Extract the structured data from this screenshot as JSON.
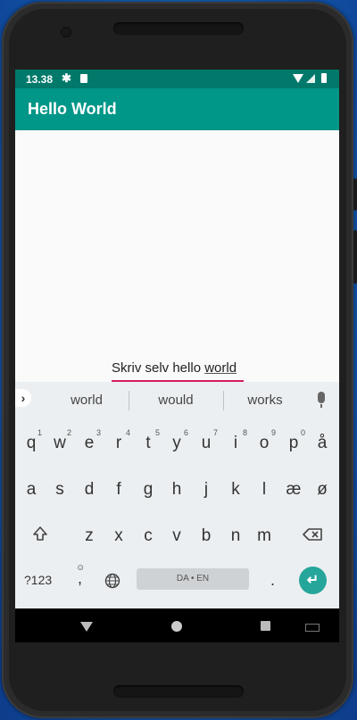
{
  "status_bar": {
    "time": "13.38"
  },
  "app_bar": {
    "title": "Hello World"
  },
  "edit_field": {
    "text_before": "Skriv selv hello ",
    "text_word": "world"
  },
  "keyboard": {
    "suggestions": [
      "world",
      "would",
      "works"
    ],
    "row1": [
      "q",
      "w",
      "e",
      "r",
      "t",
      "y",
      "u",
      "i",
      "o",
      "p",
      "å"
    ],
    "row1_hints": [
      "1",
      "2",
      "3",
      "4",
      "5",
      "6",
      "7",
      "8",
      "9",
      "0"
    ],
    "row2": [
      "a",
      "s",
      "d",
      "f",
      "g",
      "h",
      "j",
      "k",
      "l",
      "æ",
      "ø"
    ],
    "row3": [
      "z",
      "x",
      "c",
      "v",
      "b",
      "n",
      "m"
    ],
    "symbols_key": "?123",
    "emoji_comma": ",",
    "space_label": "DA • EN",
    "period": "."
  },
  "colors": {
    "status_bar": "#00796b",
    "app_bar": "#009688",
    "accent": "#d81b60",
    "enter_key": "#26a69a"
  },
  "icons": {
    "status_left": [
      "gear-icon",
      "sd-card-icon"
    ],
    "status_right": [
      "wifi-icon",
      "signal-icon",
      "battery-icon"
    ],
    "keyboard": [
      "chevron-right-icon",
      "mic-icon",
      "shift-icon",
      "backspace-icon",
      "emoji-icon",
      "globe-icon",
      "enter-icon"
    ],
    "nav": [
      "back-icon",
      "home-icon",
      "recents-icon",
      "keyboard-switch-icon"
    ]
  }
}
